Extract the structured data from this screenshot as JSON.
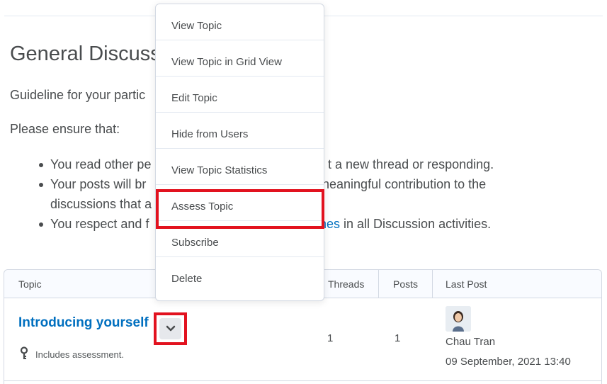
{
  "page": {
    "title": "General Discuss",
    "guideline": "Guideline for your partic",
    "ensure": "Please ensure that:",
    "bullets": [
      {
        "start": "You read other pe",
        "tail": "t a new thread or responding."
      },
      {
        "start": "Your posts will br",
        "tail": "neaningful contribution to the",
        "cont": "discussions that a"
      },
      {
        "start": "You respect and f",
        "link": "nes",
        "tail": " in all Discussion activities."
      }
    ]
  },
  "table": {
    "headers": {
      "topic": "Topic",
      "threads": "Threads",
      "posts": "Posts",
      "last_post": "Last Post"
    },
    "row": {
      "topic": "Introducing yourself",
      "note": "Includes assessment.",
      "threads": "1",
      "posts": "1",
      "last_post_user": "Chau Tran",
      "last_post_date": "09 September, 2021 13:40"
    }
  },
  "menu": {
    "items": [
      "View Topic",
      "View Topic in Grid View",
      "Edit Topic",
      "Hide from Users",
      "View Topic Statistics",
      "Assess Topic",
      "Subscribe",
      "Delete"
    ],
    "highlighted": "Assess Topic"
  },
  "colors": {
    "link": "#006fbf",
    "highlight": "#e2121f",
    "text": "#494c4e"
  },
  "icons": {
    "chevron": "chevron-down-icon",
    "key": "key-icon",
    "avatar": "user-avatar"
  }
}
